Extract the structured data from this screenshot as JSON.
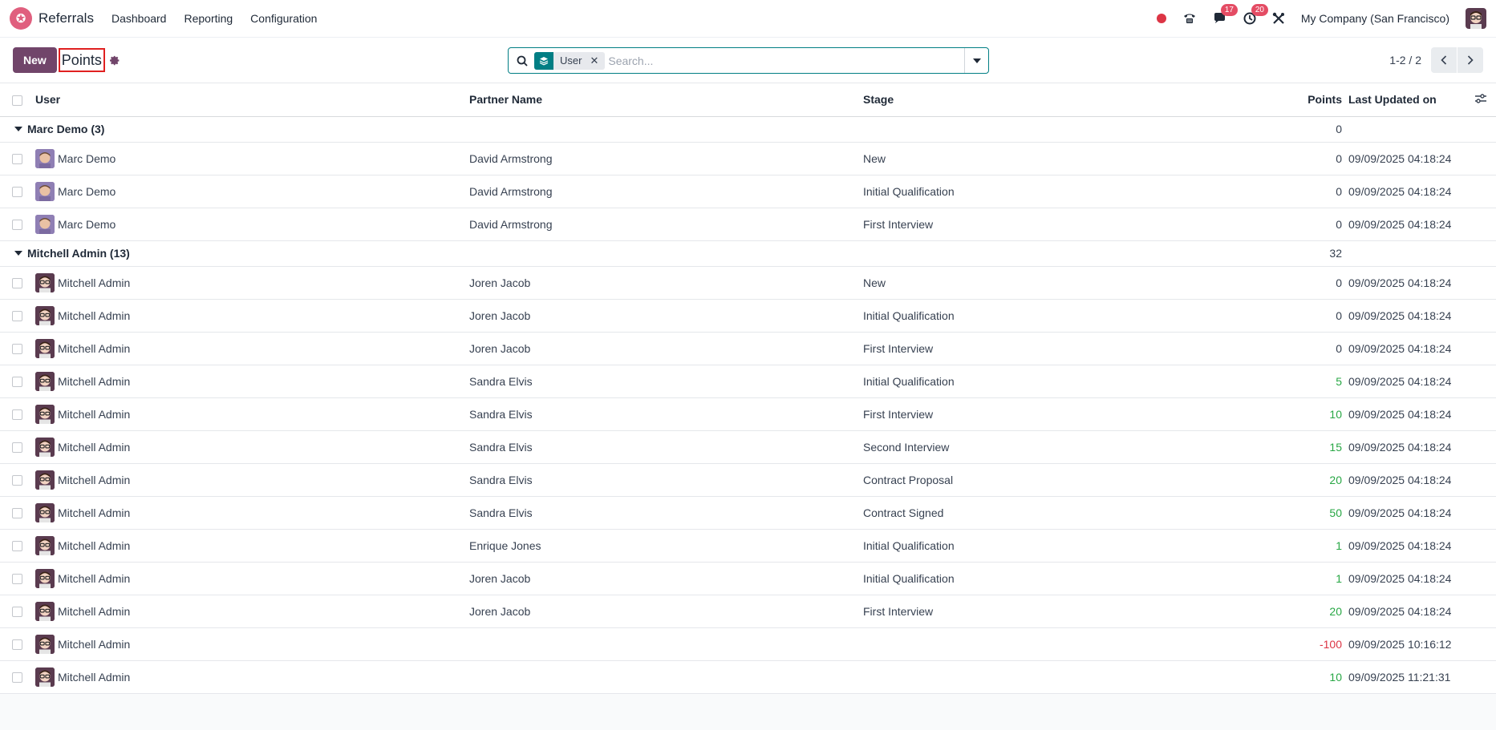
{
  "navbar": {
    "app_name": "Referrals",
    "menu": [
      "Dashboard",
      "Reporting",
      "Configuration"
    ],
    "messages_badge": "17",
    "activities_badge": "20",
    "company": "My Company (San Francisco)"
  },
  "control": {
    "new_label": "New",
    "breadcrumb": "Points",
    "facet_value": "User",
    "search_placeholder": "Search...",
    "pager": "1-2 / 2"
  },
  "table": {
    "headers": {
      "user": "User",
      "partner": "Partner Name",
      "stage": "Stage",
      "points": "Points",
      "updated": "Last Updated on"
    },
    "groups": [
      {
        "label": "Marc Demo (3)",
        "total": "0",
        "avatar": "marc",
        "rows": [
          {
            "user": "Marc Demo",
            "partner": "David Armstrong",
            "stage": "New",
            "points": "0",
            "updated": "09/09/2025 04:18:24"
          },
          {
            "user": "Marc Demo",
            "partner": "David Armstrong",
            "stage": "Initial Qualification",
            "points": "0",
            "updated": "09/09/2025 04:18:24"
          },
          {
            "user": "Marc Demo",
            "partner": "David Armstrong",
            "stage": "First Interview",
            "points": "0",
            "updated": "09/09/2025 04:18:24"
          }
        ]
      },
      {
        "label": "Mitchell Admin (13)",
        "total": "32",
        "avatar": "mitchell",
        "rows": [
          {
            "user": "Mitchell Admin",
            "partner": "Joren Jacob",
            "stage": "New",
            "points": "0",
            "updated": "09/09/2025 04:18:24"
          },
          {
            "user": "Mitchell Admin",
            "partner": "Joren Jacob",
            "stage": "Initial Qualification",
            "points": "0",
            "updated": "09/09/2025 04:18:24"
          },
          {
            "user": "Mitchell Admin",
            "partner": "Joren Jacob",
            "stage": "First Interview",
            "points": "0",
            "updated": "09/09/2025 04:18:24"
          },
          {
            "user": "Mitchell Admin",
            "partner": "Sandra Elvis",
            "stage": "Initial Qualification",
            "points": "5",
            "updated": "09/09/2025 04:18:24"
          },
          {
            "user": "Mitchell Admin",
            "partner": "Sandra Elvis",
            "stage": "First Interview",
            "points": "10",
            "updated": "09/09/2025 04:18:24"
          },
          {
            "user": "Mitchell Admin",
            "partner": "Sandra Elvis",
            "stage": "Second Interview",
            "points": "15",
            "updated": "09/09/2025 04:18:24"
          },
          {
            "user": "Mitchell Admin",
            "partner": "Sandra Elvis",
            "stage": "Contract Proposal",
            "points": "20",
            "updated": "09/09/2025 04:18:24"
          },
          {
            "user": "Mitchell Admin",
            "partner": "Sandra Elvis",
            "stage": "Contract Signed",
            "points": "50",
            "updated": "09/09/2025 04:18:24"
          },
          {
            "user": "Mitchell Admin",
            "partner": "Enrique Jones",
            "stage": "Initial Qualification",
            "points": "1",
            "updated": "09/09/2025 04:18:24"
          },
          {
            "user": "Mitchell Admin",
            "partner": "Joren Jacob",
            "stage": "Initial Qualification",
            "points": "1",
            "updated": "09/09/2025 04:18:24"
          },
          {
            "user": "Mitchell Admin",
            "partner": "Joren Jacob",
            "stage": "First Interview",
            "points": "20",
            "updated": "09/09/2025 04:18:24"
          },
          {
            "user": "Mitchell Admin",
            "partner": "",
            "stage": "",
            "points": "-100",
            "updated": "09/09/2025 10:16:12"
          },
          {
            "user": "Mitchell Admin",
            "partner": "",
            "stage": "",
            "points": "10",
            "updated": "09/09/2025 11:21:31"
          }
        ]
      }
    ]
  },
  "colors": {
    "brand": "#71456a",
    "accent": "#017e84",
    "positive": "#28a745",
    "negative": "#dc3545",
    "badge": "#e44c64"
  }
}
